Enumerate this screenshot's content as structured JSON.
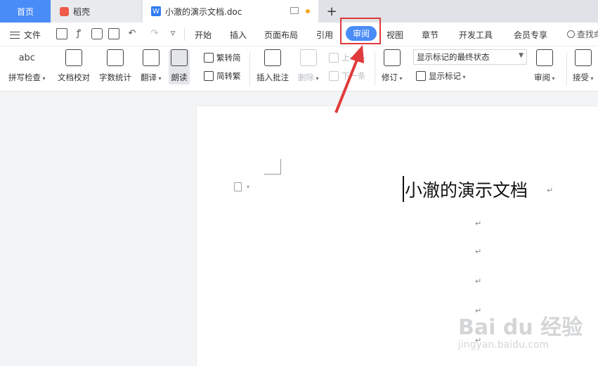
{
  "tabs": {
    "home": "首页",
    "shell": "稻壳",
    "doc": "小澈的演示文档.doc",
    "new": "+"
  },
  "menubar": {
    "file": "文件",
    "items": [
      "开始",
      "插入",
      "页面布局",
      "引用",
      "审阅",
      "视图",
      "章节",
      "开发工具",
      "会员专享"
    ],
    "active": "审阅",
    "search": "查找命"
  },
  "ribbon": {
    "spell": "拼写检查",
    "proof": "文档校对",
    "wordcount": "字数统计",
    "translate": "翻译",
    "read": "朗读",
    "trad_to_simp": "繁转简",
    "simp_to_trad": "简转繁",
    "insert_comment": "插入批注",
    "delete": "删除",
    "prev": "上一条",
    "next": "下一条",
    "revise": "修订",
    "final_state": "显示标记的最终状态",
    "show_markup": "显示标记",
    "review": "审阅",
    "accept": "接受",
    "icon_abc": "abc"
  },
  "document": {
    "title": "小澈的演示文档",
    "paragraph_mark": "↵"
  },
  "watermark": {
    "brand": "Bai du 经验",
    "url": "jingyan.baidu.com"
  },
  "colors": {
    "accent": "#4a8cf7",
    "highlight": "#e03a3a"
  }
}
